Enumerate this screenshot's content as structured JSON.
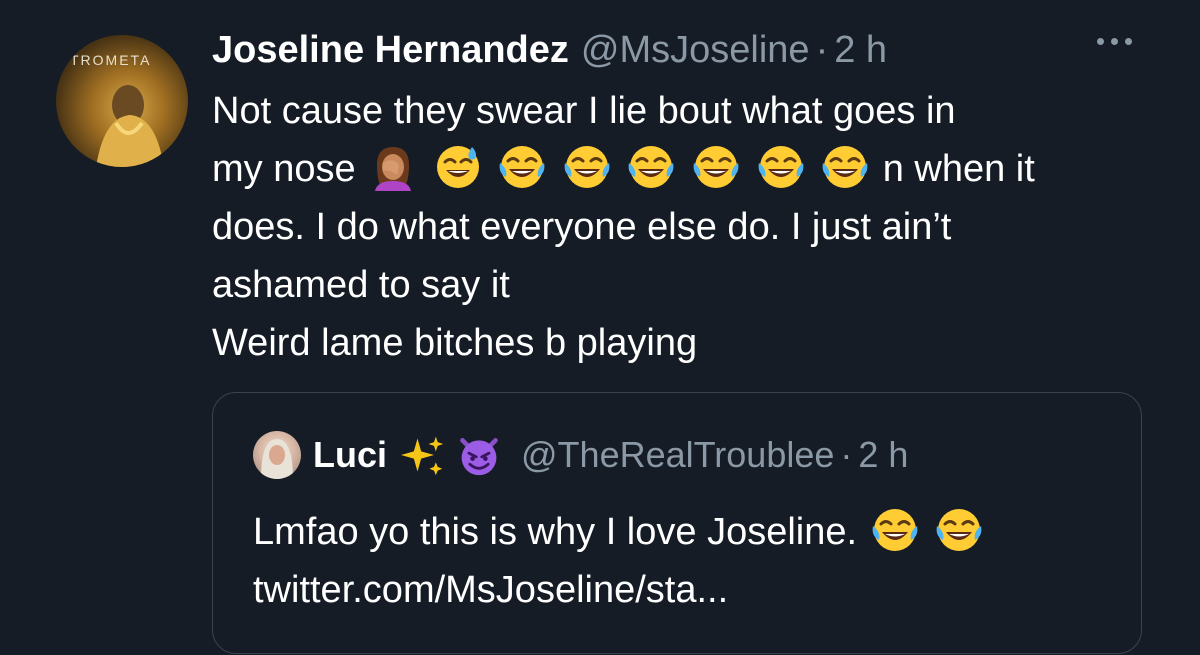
{
  "tweet": {
    "display_name": "Joseline Hernandez",
    "handle": "@MsJoseline",
    "separator": "·",
    "time": "2 h",
    "line1": "Not cause they swear I lie bout what goes in",
    "line2_start": "my nose",
    "line2_end": "n when it",
    "line3": "does. I do what everyone else do. I just ain’t",
    "line4": "ashamed to say it",
    "line5": "Weird lame bitches b playing",
    "avatar_text": "TROMETA",
    "emojis": [
      "face-palm-emoji",
      "sweat-smile-emoji",
      "joy-emoji",
      "joy-emoji",
      "joy-emoji",
      "joy-emoji",
      "joy-emoji",
      "joy-emoji"
    ]
  },
  "quoted_tweet": {
    "display_name": "Luci",
    "name_emojis": [
      "sparkles-emoji",
      "smiling-imp-emoji"
    ],
    "handle": "@TheRealTroublee",
    "separator": "·",
    "time": "2 h",
    "line1": "Lmfao yo this is why I love Joseline.",
    "line2": "twitter.com/MsJoseline/sta...",
    "emojis": [
      "joy-emoji",
      "joy-emoji"
    ]
  },
  "colors": {
    "background": "#151c25",
    "text": "#ffffff",
    "muted": "#8b98a5",
    "border": "#38444d"
  }
}
